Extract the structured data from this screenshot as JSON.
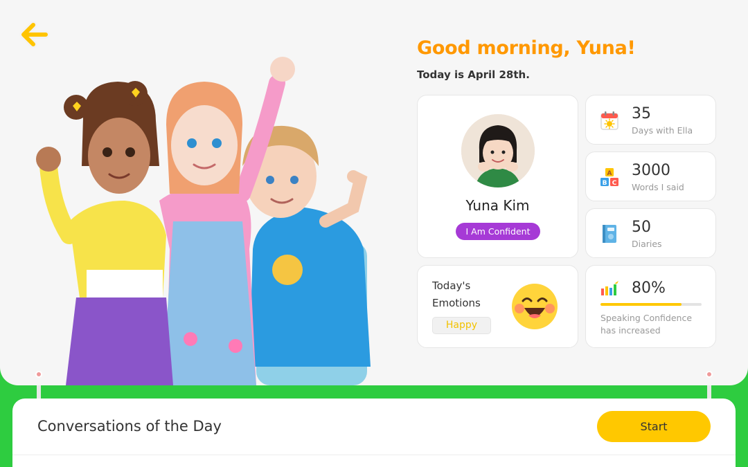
{
  "header": {
    "greeting": "Good morning, Yuna!",
    "date_line": "Today is April 28th."
  },
  "profile": {
    "name": "Yuna Kim",
    "badge": "I Am Confident"
  },
  "stats": [
    {
      "value": "35",
      "label": "Days with Ella",
      "icon": "calendar-icon"
    },
    {
      "value": "3000",
      "label": "Words I said",
      "icon": "abc-blocks-icon"
    },
    {
      "value": "50",
      "label": "Diaries",
      "icon": "diary-icon"
    }
  ],
  "emotion": {
    "title_line1": "Today's",
    "title_line2": "Emotions",
    "value": "Happy",
    "icon": "laughing-face-icon"
  },
  "confidence": {
    "value": "80%",
    "progress": 0.8,
    "label_line1": "Speaking Confidence",
    "label_line2": "has increased",
    "icon": "bar-chart-icon"
  },
  "conversations": {
    "title": "Conversations of the Day",
    "start_label": "Start"
  },
  "colors": {
    "accent_orange": "#ff9800",
    "accent_yellow": "#ffc800",
    "badge_purple": "#a63ad6",
    "background_green": "#2ecc40"
  }
}
